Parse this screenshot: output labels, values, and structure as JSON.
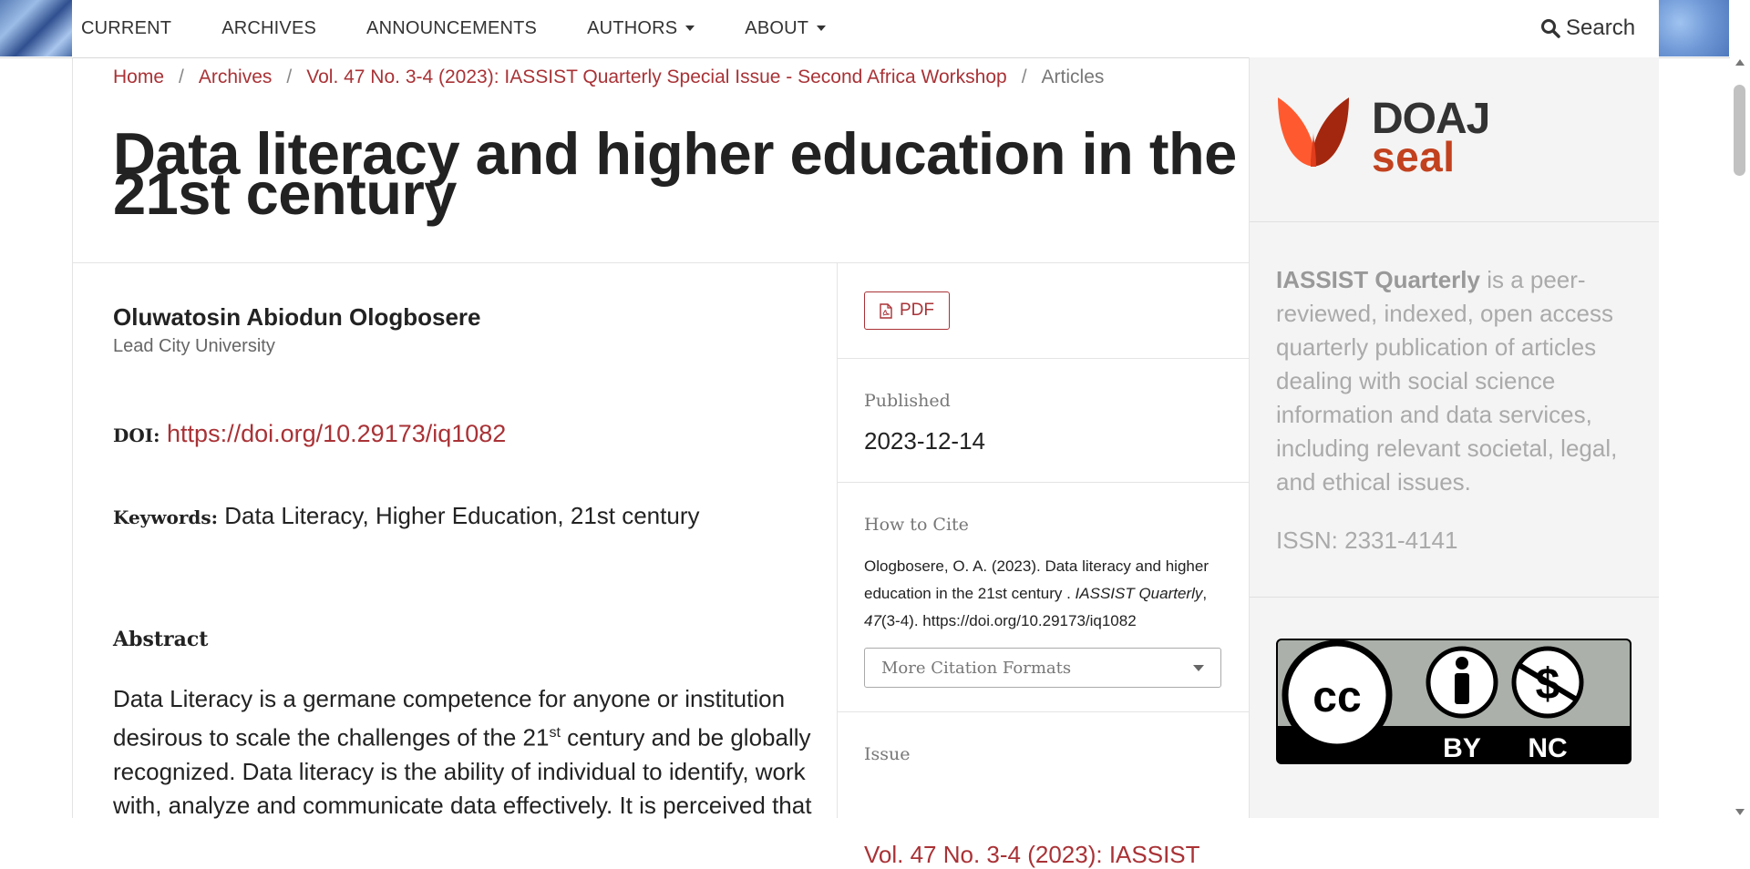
{
  "nav": {
    "items": [
      {
        "label": "CURRENT",
        "has_caret": false
      },
      {
        "label": "ARCHIVES",
        "has_caret": false
      },
      {
        "label": "ANNOUNCEMENTS",
        "has_caret": false
      },
      {
        "label": "AUTHORS",
        "has_caret": true
      },
      {
        "label": "ABOUT",
        "has_caret": true
      }
    ],
    "search_label": "Search",
    "search_icon": "search-icon"
  },
  "breadcrumb": {
    "home": "Home",
    "archives": "Archives",
    "issue": "Vol. 47 No. 3-4 (2023): IASSIST Quarterly Special Issue - Second Africa Workshop",
    "current": "Articles",
    "separator": "/"
  },
  "article": {
    "title": "Data literacy and higher education in the 21st century",
    "author_name": "Oluwatosin Abiodun Ologbosere",
    "affiliation": "Lead City University",
    "doi_label": "DOI:",
    "doi_url": "https://doi.org/10.29173/iq1082",
    "keywords_label": "Keywords:",
    "keywords": "Data Literacy, Higher Education, 21st century",
    "abstract_heading": "Abstract",
    "abstract_part1": "Data Literacy is a germane competence for anyone or institution desirous to scale the challenges of the 21",
    "abstract_sup": "st",
    "abstract_part2": " century and be globally recognized. Data literacy is the ability of individual to identify, work with, analyze and communicate data effectively. It is perceived that"
  },
  "details": {
    "pdf_label": "PDF",
    "pdf_icon": "file-pdf-icon",
    "published_label": "Published",
    "published_date": "2023-12-14",
    "cite_label": "How to Cite",
    "citation_pre": "Ologbosere, O. A. (2023). Data literacy and higher education in the 21st century . ",
    "citation_journal": "IASSIST Quarterly",
    "citation_sep": ", ",
    "citation_volume": "47",
    "citation_post": "(3-4). https://doi.org/10.29173/iq1082",
    "more_formats": "More Citation Formats",
    "issue_label": "Issue",
    "issue_link": "Vol. 47 No. 3-4 (2023): IASSIST"
  },
  "sidebar": {
    "doaj_word": "DOAJ",
    "seal_word": "seal",
    "journal_name": "IASSIST Quarterly",
    "journal_desc": " is a peer-reviewed, indexed, open access quarterly publication of articles dealing with social science information and data services, including relevant societal, legal, and ethical issues.",
    "issn": "ISSN: 2331-4141",
    "license_cc": "cc",
    "license_by": "BY",
    "license_nc": "NC"
  },
  "colors": {
    "accent": "#a93236",
    "doaj_orange": "#ff5a2f",
    "doaj_dark": "#a3270e",
    "sidebar_bg": "#f4f4f4"
  }
}
